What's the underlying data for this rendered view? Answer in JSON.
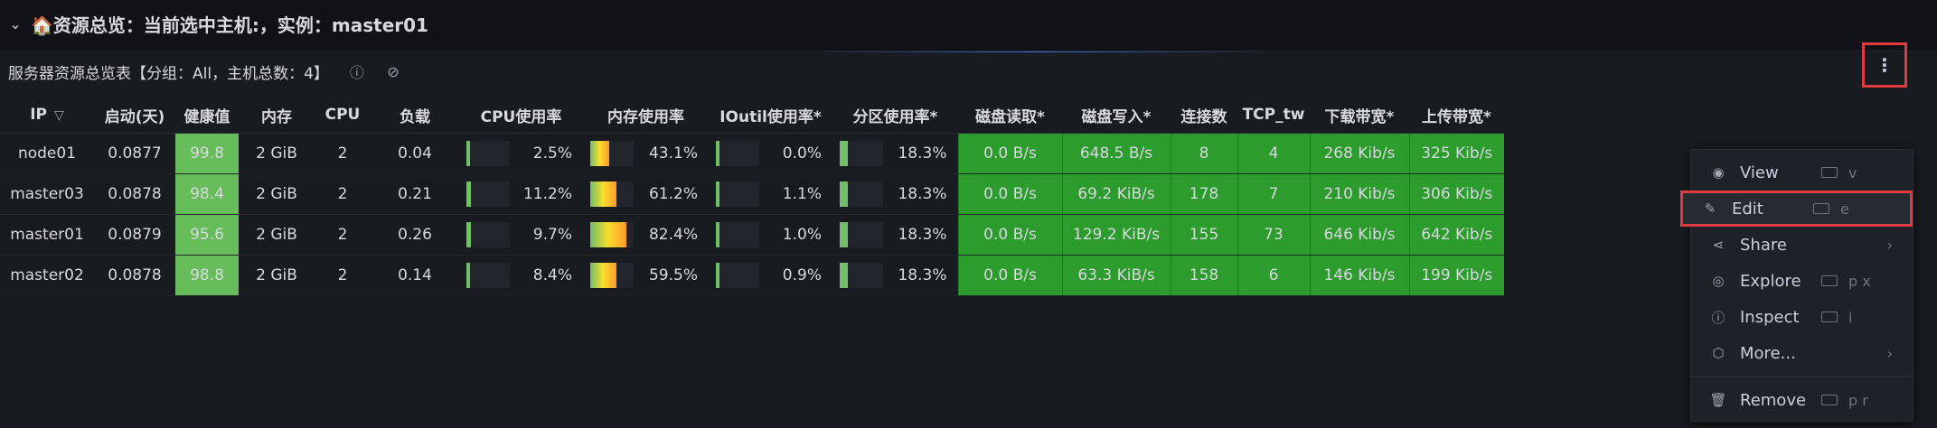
{
  "row": {
    "title": "🏠资源总览：当前选中主机:，实例：master01"
  },
  "panel": {
    "title": "服务器资源总览表【分组：All，主机总数：4】"
  },
  "table": {
    "headers": [
      "IP",
      "启动(天)",
      "健康值",
      "内存",
      "CPU",
      "负载",
      "CPU使用率",
      "内存使用率",
      "IOutil使用率*",
      "分区使用率*",
      "磁盘读取*",
      "磁盘写入*",
      "连接数",
      "TCP_tw",
      "下载带宽*",
      "上传带宽*"
    ],
    "rows": [
      {
        "ip": "node01",
        "uptime": "0.0877",
        "health": "99.8",
        "mem": "2 GiB",
        "cpu": "2",
        "load": "0.04",
        "cpu_pct": "2.5%",
        "cpu_frac": 0.025,
        "mem_pct": "43.1%",
        "mem_frac": 0.431,
        "io_pct": "0.0%",
        "io_frac": 0.0,
        "part_pct": "18.3%",
        "part_frac": 0.183,
        "disk_read": "0.0 B/s",
        "disk_write": "648.5 B/s",
        "conns": "8",
        "tcp_tw": "4",
        "down": "268 Kib/s",
        "up": "325 Kib/s"
      },
      {
        "ip": "master03",
        "uptime": "0.0878",
        "health": "98.4",
        "mem": "2 GiB",
        "cpu": "2",
        "load": "0.21",
        "cpu_pct": "11.2%",
        "cpu_frac": 0.112,
        "mem_pct": "61.2%",
        "mem_frac": 0.612,
        "io_pct": "1.1%",
        "io_frac": 0.011,
        "part_pct": "18.3%",
        "part_frac": 0.183,
        "disk_read": "0.0 B/s",
        "disk_write": "69.2 KiB/s",
        "conns": "178",
        "tcp_tw": "7",
        "down": "210 Kib/s",
        "up": "306 Kib/s"
      },
      {
        "ip": "master01",
        "uptime": "0.0879",
        "health": "95.6",
        "mem": "2 GiB",
        "cpu": "2",
        "load": "0.26",
        "cpu_pct": "9.7%",
        "cpu_frac": 0.097,
        "mem_pct": "82.4%",
        "mem_frac": 0.824,
        "io_pct": "1.0%",
        "io_frac": 0.01,
        "part_pct": "18.3%",
        "part_frac": 0.183,
        "disk_read": "0.0 B/s",
        "disk_write": "129.2 KiB/s",
        "conns": "155",
        "tcp_tw": "73",
        "down": "646 Kib/s",
        "up": "642 Kib/s"
      },
      {
        "ip": "master02",
        "uptime": "0.0878",
        "health": "98.8",
        "mem": "2 GiB",
        "cpu": "2",
        "load": "0.14",
        "cpu_pct": "8.4%",
        "cpu_frac": 0.084,
        "mem_pct": "59.5%",
        "mem_frac": 0.595,
        "io_pct": "0.9%",
        "io_frac": 0.009,
        "part_pct": "18.3%",
        "part_frac": 0.183,
        "disk_read": "0.0 B/s",
        "disk_write": "63.3 KiB/s",
        "conns": "158",
        "tcp_tw": "6",
        "down": "146 Kib/s",
        "up": "199 Kib/s"
      }
    ]
  },
  "menu": {
    "items": [
      {
        "label": "View",
        "shortcut": "v",
        "icon": "eye-icon"
      },
      {
        "label": "Edit",
        "shortcut": "e",
        "icon": "edit-icon"
      },
      {
        "label": "Share",
        "shortcut": "",
        "icon": "share-icon"
      },
      {
        "label": "Explore",
        "shortcut": "p x",
        "icon": "compass-icon"
      },
      {
        "label": "Inspect",
        "shortcut": "i",
        "icon": "info-icon"
      },
      {
        "label": "More...",
        "shortcut": "",
        "icon": "cube-icon"
      },
      {
        "label": "Remove",
        "shortcut": "p r",
        "icon": "trash-icon"
      }
    ]
  },
  "colors": {
    "health_bg": "#66bd59",
    "cell_green": "#2c9c2c",
    "link": "#6e9fff",
    "highlight": "#e0393e"
  }
}
